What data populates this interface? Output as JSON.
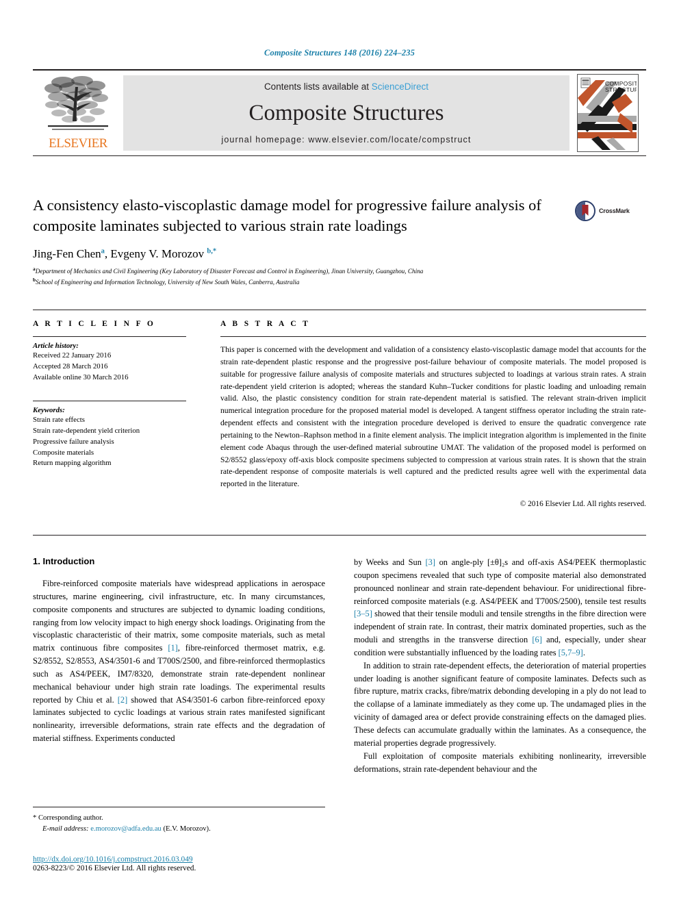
{
  "running_head": "Composite Structures 148 (2016) 224–235",
  "masthead": {
    "publisher_name": "ELSEVIER",
    "contents_prefix": "Contents lists available at ",
    "sciencedirect": "ScienceDirect",
    "journal_title": "Composite Structures",
    "homepage_label": "journal homepage: www.elsevier.com/locate/compstruct",
    "cover_title_line1": "COMPOSITE",
    "cover_title_line2": "STRUCTURES"
  },
  "article": {
    "title": "A consistency elasto-viscoplastic damage model for progressive failure analysis of composite laminates subjected to various strain rate loadings",
    "crossmark_label": "CrossMark",
    "authors_html": "Jing-Fen Chen<sup>a</sup>, Evgeny V. Morozov <sup>b,</sup><sup>*</sup>",
    "affiliation_a": "Department of Mechanics and Civil Engineering (Key Laboratory of Disaster Forecast and Control in Engineering), Jinan University, Guangzhou, China",
    "affiliation_b": "School of Engineering and Information Technology, University of New South Wales, Canberra, Australia"
  },
  "article_info": {
    "heading": "A R T I C L E   I N F O",
    "history_label": "Article history:",
    "history": [
      "Received 22 January 2016",
      "Accepted 28 March 2016",
      "Available online 30 March 2016"
    ],
    "keywords_label": "Keywords:",
    "keywords": [
      "Strain rate effects",
      "Strain rate-dependent yield criterion",
      "Progressive failure analysis",
      "Composite materials",
      "Return mapping algorithm"
    ]
  },
  "abstract": {
    "heading": "A B S T R A C T",
    "text": "This paper is concerned with the development and validation of a consistency elasto-viscoplastic damage model that accounts for the strain rate-dependent plastic response and the progressive post-failure behaviour of composite materials. The model proposed is suitable for progressive failure analysis of composite materials and structures subjected to loadings at various strain rates. A strain rate-dependent yield criterion is adopted; whereas the standard Kuhn–Tucker conditions for plastic loading and unloading remain valid. Also, the plastic consistency condition for strain rate-dependent material is satisfied. The relevant strain-driven implicit numerical integration procedure for the proposed material model is developed. A tangent stiffness operator including the strain rate-dependent effects and consistent with the integration procedure developed is derived to ensure the quadratic convergence rate pertaining to the Newton–Raphson method in a finite element analysis. The implicit integration algorithm is implemented in the finite element code Abaqus through the user-defined material subroutine UMAT. The validation of the proposed model is performed on S2/8552 glass/epoxy off-axis block composite specimens subjected to compression at various strain rates. It is shown that the strain rate-dependent response of composite materials is well captured and the predicted results agree well with the experimental data reported in the literature.",
    "copyright": "© 2016 Elsevier Ltd. All rights reserved."
  },
  "introduction": {
    "heading": "1. Introduction",
    "left_para_1_a": "Fibre-reinforced composite materials have widespread applications in aerospace structures, marine engineering, civil infrastructure, etc. In many circumstances, composite components and structures are subjected to dynamic loading conditions, ranging from low velocity impact to high energy shock loadings. Originating from the viscoplastic characteristic of their matrix, some composite materials, such as metal matrix continuous fibre composites ",
    "left_ref_1": "[1]",
    "left_para_1_b": ", fibre-reinforced thermoset matrix, e.g. S2/8552, S2/8553, AS4/3501-6 and T700S/2500, and fibre-reinforced thermoplastics such as AS4/PEEK, IM7/8320, demonstrate strain rate-dependent nonlinear mechanical behaviour under high strain rate loadings. The experimental results reported by Chiu et al. ",
    "left_ref_2": "[2]",
    "left_para_1_c": " showed that AS4/3501-6 carbon fibre-reinforced epoxy laminates subjected to cyclic loadings at various strain rates manifested significant nonlinearity, irreversible deformations, strain rate effects and the degradation of material stiffness. Experiments conducted",
    "right_para_1_a": "by Weeks and Sun ",
    "right_ref_3": "[3]",
    "right_para_1_b": " on angle-ply [±θ]₂s and off-axis AS4/PEEK thermoplastic coupon specimens revealed that such type of composite material also demonstrated pronounced nonlinear and strain rate-dependent behaviour. For unidirectional fibre-reinforced composite materials (e.g. AS4/PEEK and T700S/2500), tensile test results ",
    "right_ref_35": "[3–5]",
    "right_para_1_c": " showed that their tensile moduli and tensile strengths in the fibre direction were independent of strain rate. In contrast, their matrix dominated properties, such as the moduli and strengths in the transverse direction ",
    "right_ref_6": "[6]",
    "right_para_1_d": " and, especially, under shear condition were substantially influenced by the loading rates ",
    "right_ref_579": "[5,7–9]",
    "right_para_1_e": ".",
    "right_para_2": "In addition to strain rate-dependent effects, the deterioration of material properties under loading is another significant feature of composite laminates. Defects such as fibre rupture, matrix cracks, fibre/matrix debonding developing in a ply do not lead to the collapse of a laminate immediately as they come up. The undamaged plies in the vicinity of damaged area or defect provide constraining effects on the damaged plies. These defects can accumulate gradually within the laminates. As a consequence, the material properties degrade progressively.",
    "right_para_3": "Full exploitation of composite materials exhibiting nonlinearity, irreversible deformations, strain rate-dependent behaviour and the"
  },
  "footer": {
    "corresponding_marker": "*",
    "corresponding_label": "Corresponding author.",
    "email_label": "E-mail address:",
    "email": "e.morozov@adfa.edu.au",
    "email_owner": "(E.V. Morozov).",
    "doi": "http://dx.doi.org/10.1016/j.compstruct.2016.03.049",
    "issn_line": "0263-8223/© 2016 Elsevier Ltd. All rights reserved."
  },
  "colors": {
    "link": "#1a7fa8",
    "sciencedirect": "#3a9fd4",
    "elsevier_orange": "#e87722",
    "band_gray": "#e3e3e3"
  }
}
